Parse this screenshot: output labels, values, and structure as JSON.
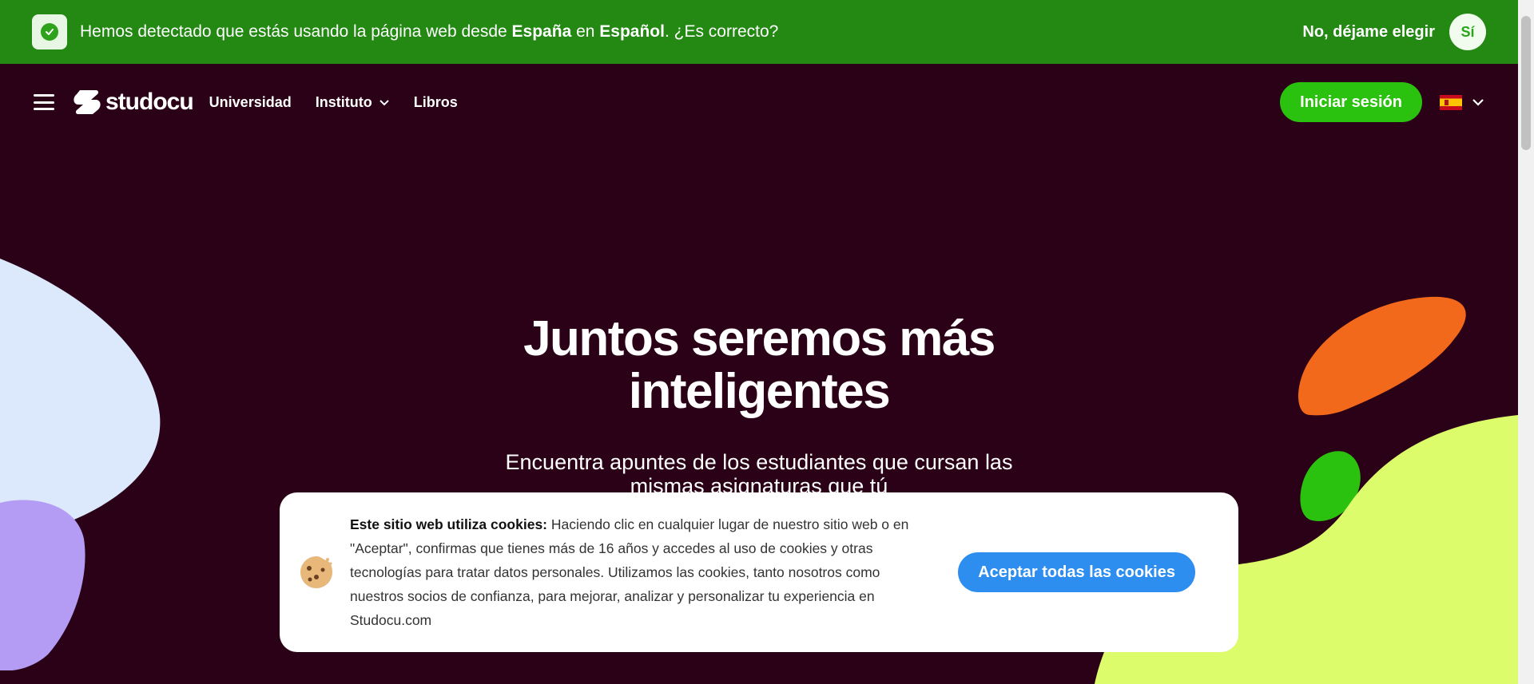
{
  "language_banner": {
    "text_before": "Hemos detectado que estás usando la página web desde ",
    "country": "España",
    "text_middle": " en ",
    "language": "Español",
    "text_after": ". ¿Es correcto?",
    "no_label": "No, déjame elegir",
    "yes_label": "Sí"
  },
  "nav": {
    "logo_text": "studocu",
    "links": [
      "Universidad",
      "Instituto",
      "Libros"
    ],
    "login_label": "Iniciar sesión",
    "language_flag": "spain-flag"
  },
  "hero": {
    "title_line1": "Juntos seremos más",
    "title_line2": "inteligentes",
    "subtitle": "Encuentra apuntes de los estudiantes que cursan las mismas asignaturas que tú"
  },
  "cookie_banner": {
    "bold_text": "Este sitio web utiliza cookies:",
    "text": " Haciendo clic en cualquier lugar de nuestro sitio web o en \"Aceptar\", confirmas que tienes más de 16 años y accedes al uso de cookies y otras tecnologías para tratar datos personales. Utilizamos las cookies, tanto nosotros como nuestros socios de confianza, para mejorar, analizar y personalizar tu experiencia en Studocu.com",
    "accept_label": "Aceptar todas las cookies"
  },
  "colors": {
    "banner_green": "#238913",
    "background": "#2a0116",
    "login_green": "#2bc20f",
    "cookie_blue": "#2e8ef0",
    "blob_lightblue": "#dce8fc",
    "blob_purple": "#b49cf4",
    "blob_orange": "#f2691c",
    "blob_green": "#2bc20f",
    "blob_lime": "#dcfc6c"
  }
}
